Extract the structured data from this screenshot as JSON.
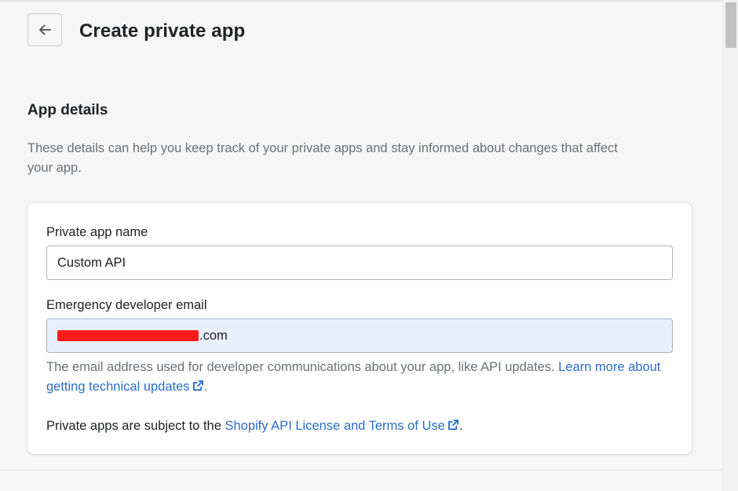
{
  "header": {
    "back_icon": "arrow-left-icon",
    "title": "Create private app"
  },
  "section": {
    "title": "App details",
    "description": "These details can help you keep track of your private apps and stay informed about changes that affect your app."
  },
  "form": {
    "app_name": {
      "label": "Private app name",
      "value": "Custom API"
    },
    "email": {
      "label": "Emergency developer email",
      "value_suffix": ".com",
      "help_text": "The email address used for developer communications about your app, like API updates. ",
      "help_link": "Learn more about getting technical updates",
      "help_end": "."
    },
    "terms": {
      "prefix": "Private apps are subject to the ",
      "link": "Shopify API License and Terms of Use",
      "end": "."
    }
  },
  "colors": {
    "link": "#2c6ecb",
    "autofill_bg": "#e8f0fe",
    "redaction": "#ff1a1a"
  },
  "icons": {
    "external": "external-link-icon"
  }
}
